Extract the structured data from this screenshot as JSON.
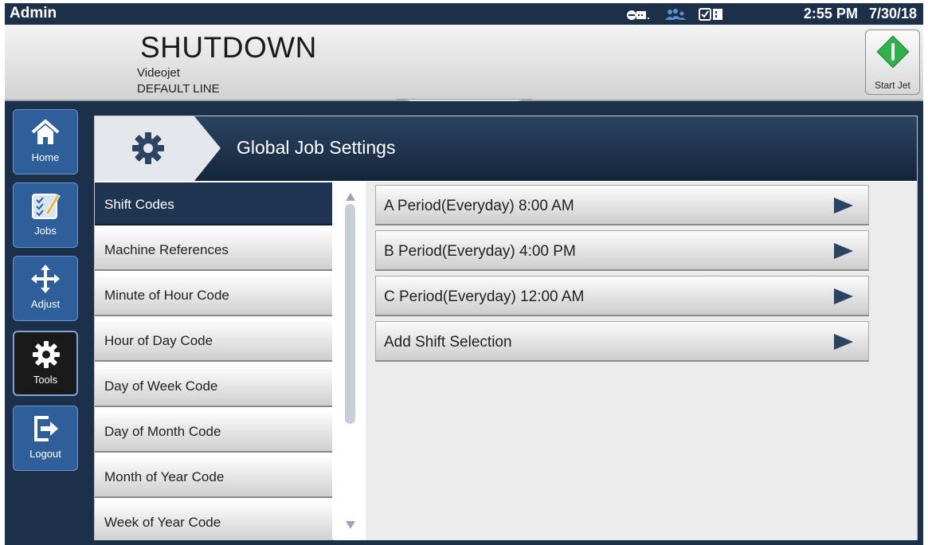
{
  "status_bar": {
    "user": "Admin",
    "time": "2:55 PM",
    "date": "7/30/18",
    "icons": [
      "ink-system-icon",
      "users-icon",
      "module-status-icon"
    ]
  },
  "header": {
    "state": "SHUTDOWN",
    "printer_name": "Videojet",
    "line_name": "DEFAULT LINE",
    "start_jet_label": "Start Jet"
  },
  "nav": {
    "items": [
      {
        "label": "Home",
        "icon": "home-icon"
      },
      {
        "label": "Jobs",
        "icon": "jobs-icon"
      },
      {
        "label": "Adjust",
        "icon": "adjust-icon"
      },
      {
        "label": "Tools",
        "icon": "tools-icon",
        "active": true
      },
      {
        "label": "Logout",
        "icon": "logout-icon"
      }
    ]
  },
  "page": {
    "title": "Global Job Settings",
    "title_icon": "gear-icon"
  },
  "categories": [
    {
      "label": "Shift Codes",
      "selected": true
    },
    {
      "label": "Machine References"
    },
    {
      "label": "Minute of Hour Code"
    },
    {
      "label": "Hour of Day Code"
    },
    {
      "label": "Day of Week Code"
    },
    {
      "label": "Day of Month Code"
    },
    {
      "label": "Month of Year Code"
    },
    {
      "label": "Week of Year Code"
    }
  ],
  "shifts": [
    {
      "label": "A  Period(Everyday) 8:00 AM"
    },
    {
      "label": "B  Period(Everyday) 4:00 PM"
    },
    {
      "label": "C  Period(Everyday) 12:00 AM"
    },
    {
      "label": "Add Shift Selection"
    }
  ],
  "colors": {
    "navy": "#1d3049",
    "nav_button": "#2e5f9a",
    "start_jet_green": "#2fb24a"
  }
}
